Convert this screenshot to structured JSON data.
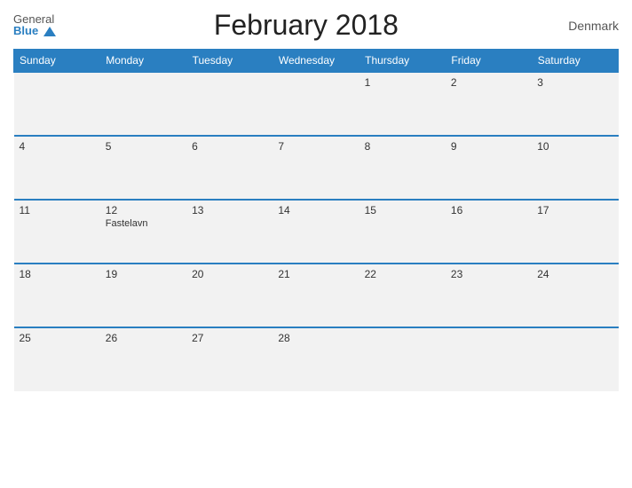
{
  "header": {
    "logo_general": "General",
    "logo_blue": "Blue",
    "title": "February 2018",
    "country": "Denmark"
  },
  "weekdays": [
    "Sunday",
    "Monday",
    "Tuesday",
    "Wednesday",
    "Thursday",
    "Friday",
    "Saturday"
  ],
  "weeks": [
    [
      {
        "day": "",
        "event": ""
      },
      {
        "day": "",
        "event": ""
      },
      {
        "day": "",
        "event": ""
      },
      {
        "day": "",
        "event": ""
      },
      {
        "day": "1",
        "event": ""
      },
      {
        "day": "2",
        "event": ""
      },
      {
        "day": "3",
        "event": ""
      }
    ],
    [
      {
        "day": "4",
        "event": ""
      },
      {
        "day": "5",
        "event": ""
      },
      {
        "day": "6",
        "event": ""
      },
      {
        "day": "7",
        "event": ""
      },
      {
        "day": "8",
        "event": ""
      },
      {
        "day": "9",
        "event": ""
      },
      {
        "day": "10",
        "event": ""
      }
    ],
    [
      {
        "day": "11",
        "event": ""
      },
      {
        "day": "12",
        "event": "Fastelavn"
      },
      {
        "day": "13",
        "event": ""
      },
      {
        "day": "14",
        "event": ""
      },
      {
        "day": "15",
        "event": ""
      },
      {
        "day": "16",
        "event": ""
      },
      {
        "day": "17",
        "event": ""
      }
    ],
    [
      {
        "day": "18",
        "event": ""
      },
      {
        "day": "19",
        "event": ""
      },
      {
        "day": "20",
        "event": ""
      },
      {
        "day": "21",
        "event": ""
      },
      {
        "day": "22",
        "event": ""
      },
      {
        "day": "23",
        "event": ""
      },
      {
        "day": "24",
        "event": ""
      }
    ],
    [
      {
        "day": "25",
        "event": ""
      },
      {
        "day": "26",
        "event": ""
      },
      {
        "day": "27",
        "event": ""
      },
      {
        "day": "28",
        "event": ""
      },
      {
        "day": "",
        "event": ""
      },
      {
        "day": "",
        "event": ""
      },
      {
        "day": "",
        "event": ""
      }
    ]
  ]
}
